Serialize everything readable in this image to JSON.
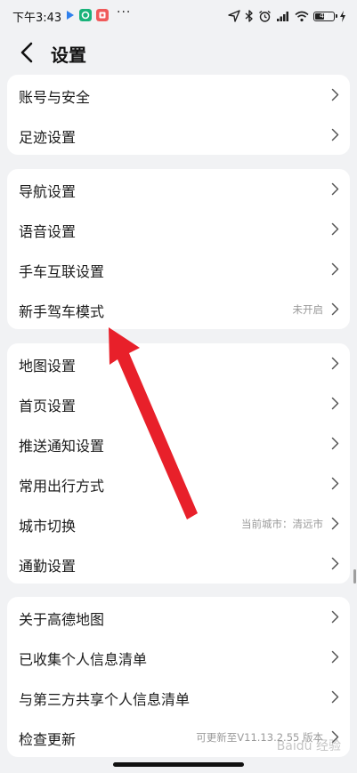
{
  "status_bar": {
    "time": "下午3:43",
    "dots": "···",
    "battery_level": "47",
    "icons": [
      "play-icon",
      "green-app-icon",
      "red-app-icon",
      "location-icon",
      "bluetooth-icon",
      "alarm-icon",
      "signal-icon",
      "wifi-icon",
      "battery-icon",
      "charging-icon"
    ]
  },
  "header": {
    "title": "设置",
    "back_icon": "chevron-left-icon"
  },
  "sections": [
    {
      "items": [
        {
          "label": "账号与安全"
        },
        {
          "label": "足迹设置"
        }
      ]
    },
    {
      "items": [
        {
          "label": "导航设置"
        },
        {
          "label": "语音设置"
        },
        {
          "label": "手车互联设置"
        },
        {
          "label": "新手驾车模式",
          "value": "未开启"
        }
      ]
    },
    {
      "items": [
        {
          "label": "地图设置"
        },
        {
          "label": "首页设置"
        },
        {
          "label": "推送通知设置"
        },
        {
          "label": "常用出行方式"
        },
        {
          "label": "城市切换",
          "value": "当前城市：清远市"
        },
        {
          "label": "通勤设置"
        }
      ]
    },
    {
      "items": [
        {
          "label": "关于高德地图"
        },
        {
          "label": "已收集个人信息清单"
        },
        {
          "label": "与第三方共享个人信息清单"
        },
        {
          "label": "检查更新",
          "value": "可更新至V11.13.2.55 版本"
        }
      ]
    }
  ],
  "watermark": "Baidu 经验",
  "colors": {
    "background": "#f1f2f4",
    "card": "#ffffff",
    "arrow": "#e8202a",
    "secondary_text": "#9a9a9a"
  }
}
